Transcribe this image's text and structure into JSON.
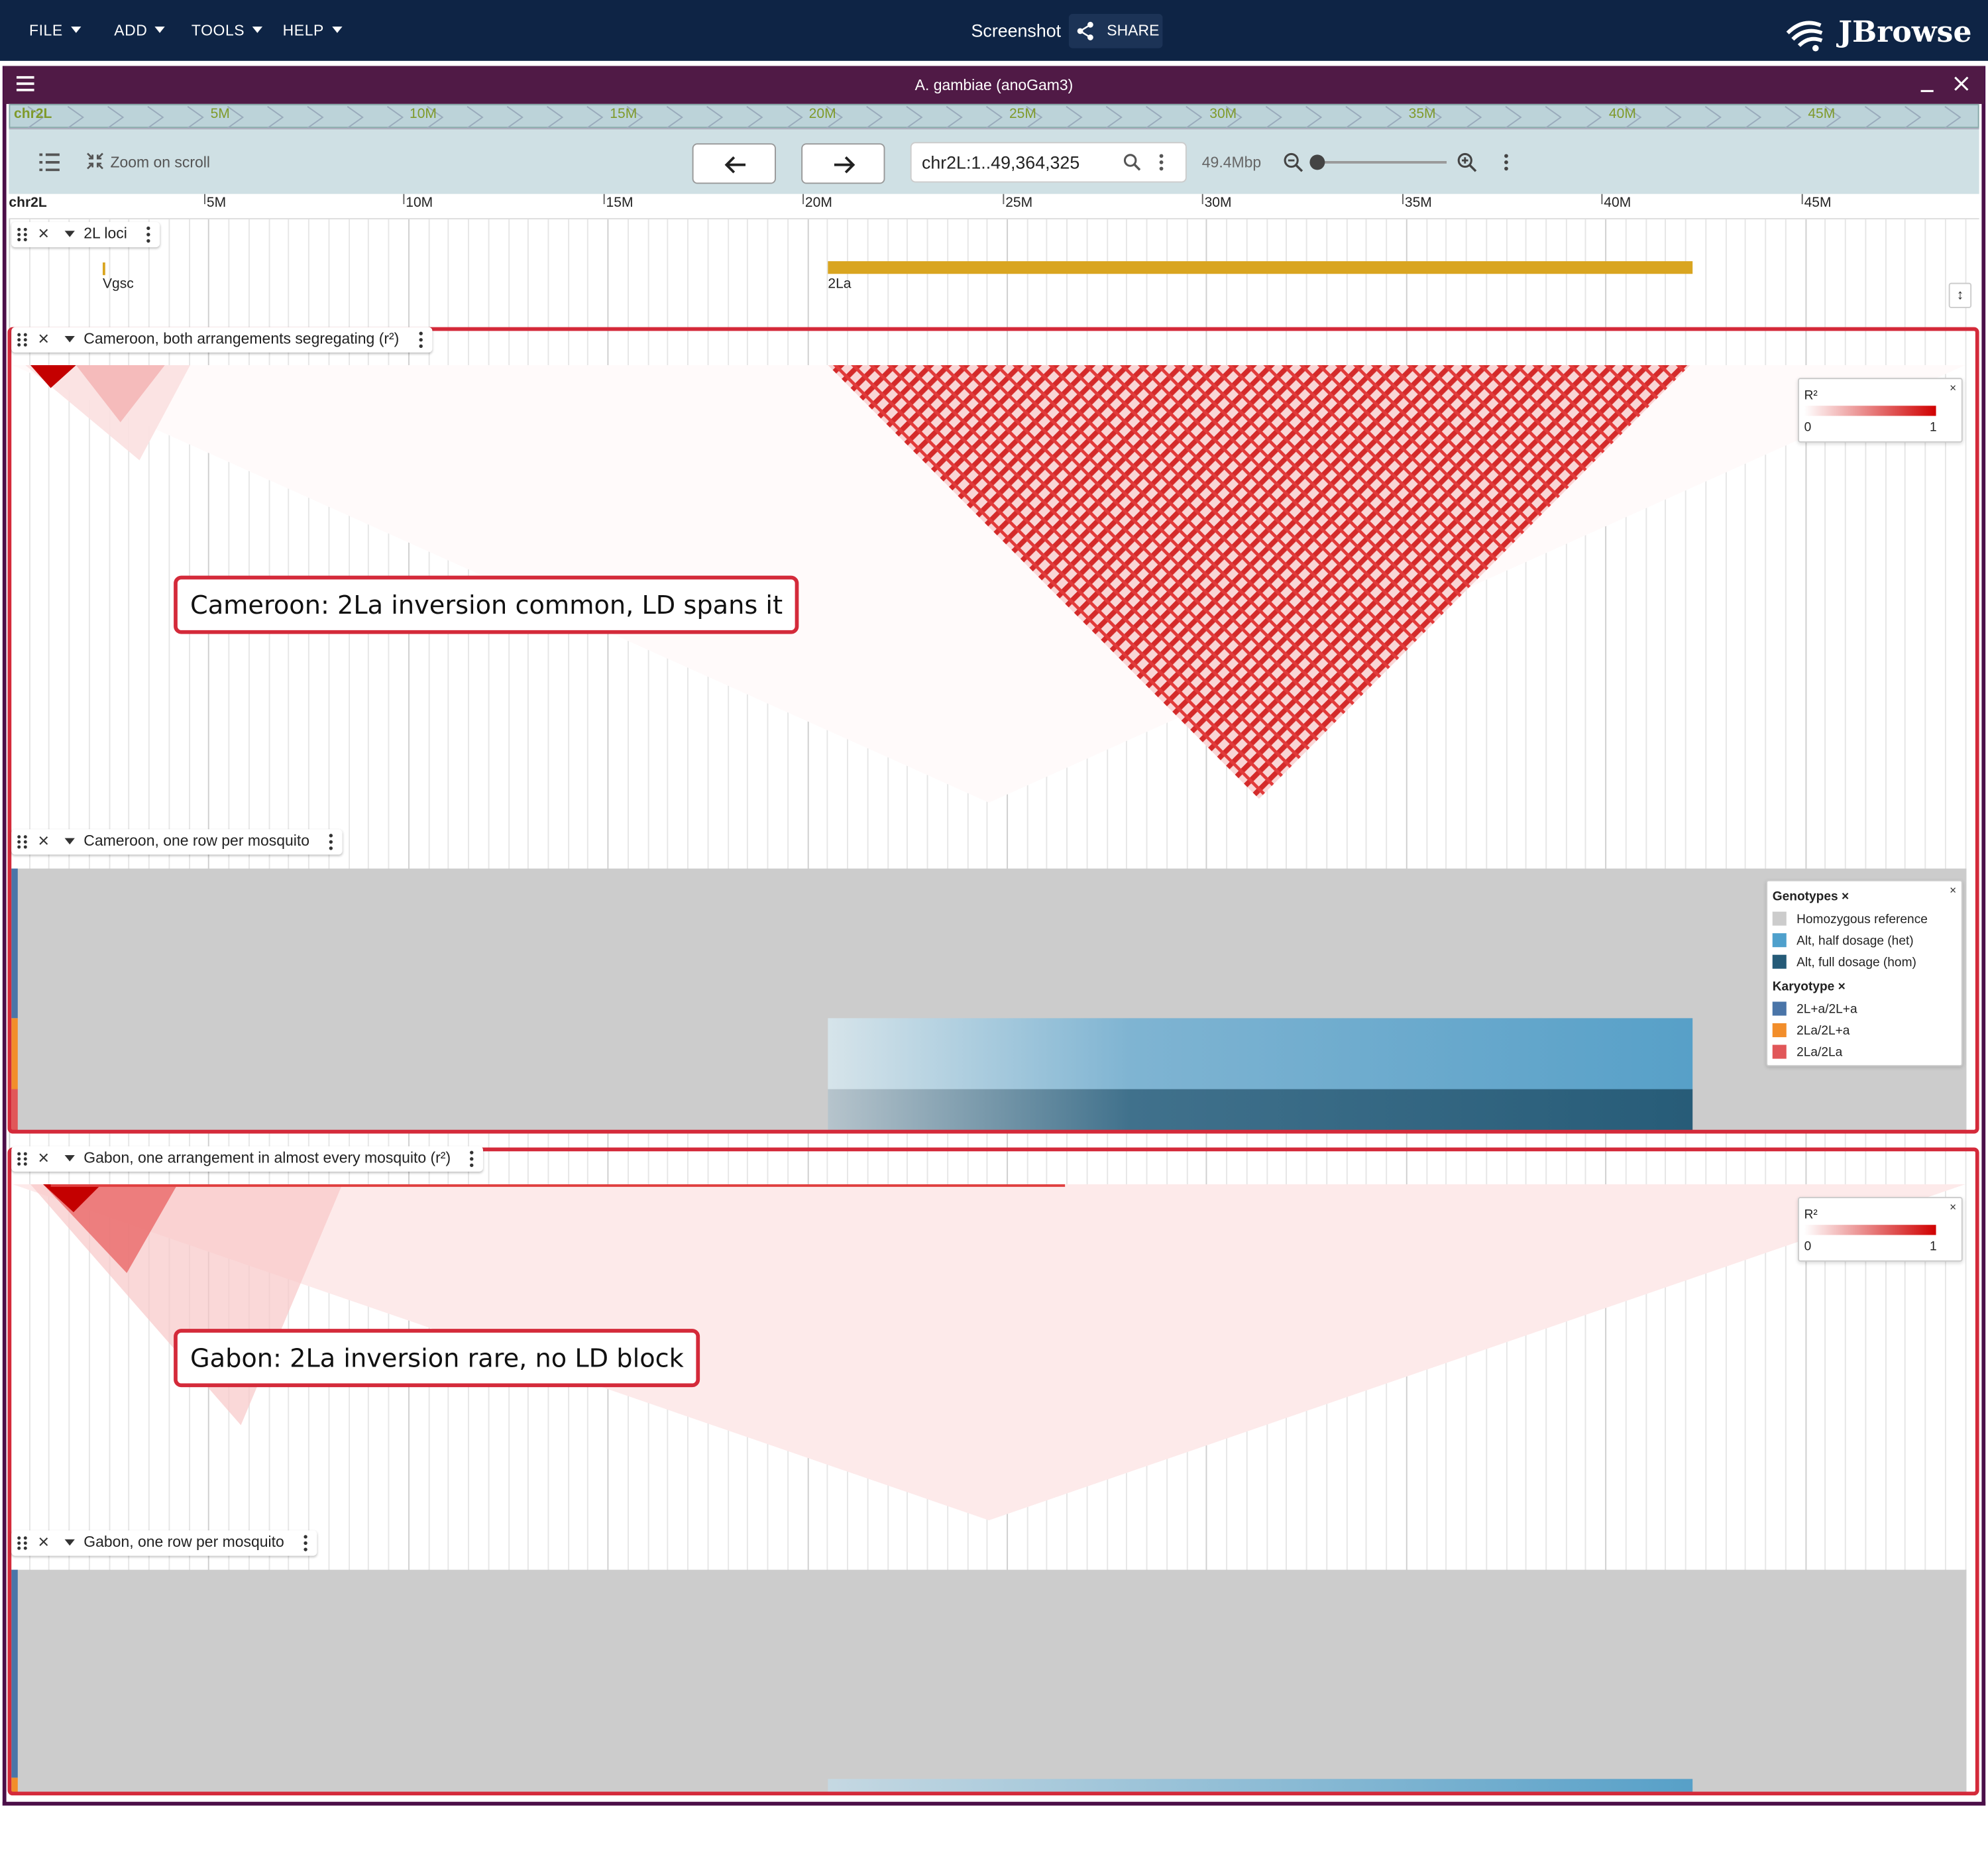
{
  "menu": [
    "FILE",
    "ADD",
    "TOOLS",
    "HELP"
  ],
  "session": {
    "name": "Screenshot",
    "share_label": "SHARE"
  },
  "logo": {
    "text": "JBrowse"
  },
  "view": {
    "title": "A. gambiae (anoGam3)",
    "overview_labels": [
      "chr2L",
      "5M",
      "10M",
      "15M",
      "20M",
      "25M",
      "30M",
      "35M",
      "40M",
      "45M"
    ],
    "zoom_on_scroll": "Zoom on scroll",
    "locstring": "chr2L:1..49,364,325",
    "bp_per_view": "49.4Mbp",
    "ruler_labels": [
      "chr2L",
      "5M",
      "10M",
      "15M",
      "20M",
      "25M",
      "30M",
      "35M",
      "40M",
      "45M"
    ]
  },
  "tracks": {
    "loci": {
      "label": "2L loci",
      "features": [
        "Vgsc",
        "2La"
      ]
    },
    "cam_ld": {
      "label": "Cameroon, both arrangements segregating (r²)",
      "annotation": "Cameroon: 2La inversion common, LD spans it"
    },
    "cam_rows": {
      "label": "Cameroon, one row per mosquito"
    },
    "gab_ld": {
      "label": "Gabon, one arrangement in almost every mosquito (r²)",
      "annotation": "Gabon: 2La inversion rare, no LD block"
    },
    "gab_rows": {
      "label": "Gabon, one row per mosquito"
    }
  },
  "r2_legend": {
    "title": "R²",
    "min": "0",
    "max": "1"
  },
  "genotype_legend": {
    "genotypes_title": "Genotypes",
    "genotypes": [
      "Homozygous reference",
      "Alt, half dosage (het)",
      "Alt, full dosage (hom)"
    ],
    "karyotype_title": "Karyotype",
    "karyotypes": [
      "2L+a/2L+a",
      "2La/2L+a",
      "2La/2La"
    ],
    "genotype_colors": [
      "#cccccc",
      "#4fa0cc",
      "#255b78"
    ],
    "karyotype_colors": [
      "#4a75a8",
      "#f28e2b",
      "#e15759"
    ]
  },
  "colors": {
    "appbar": "#0e2445",
    "view_header": "#501a46",
    "ld_red": "#d42a2a",
    "highlight": "#d42a3a",
    "locus_bar": "#d9a520"
  }
}
